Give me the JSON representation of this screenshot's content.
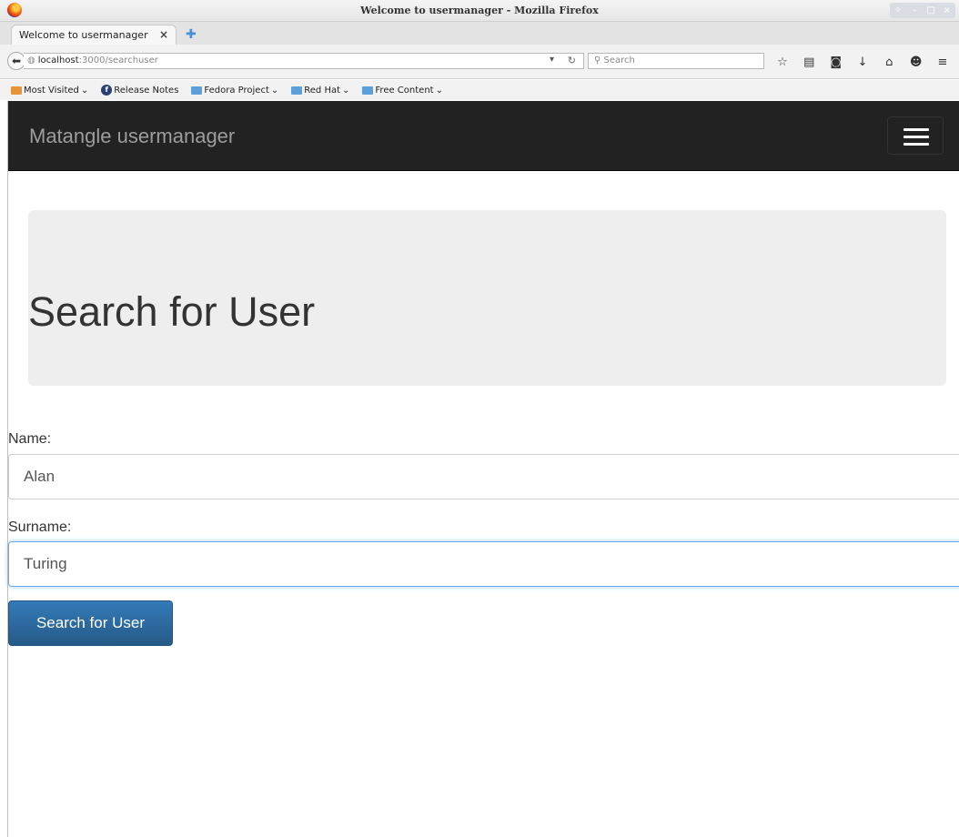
{
  "window": {
    "title": "Welcome to usermanager - Mozilla Firefox"
  },
  "tab": {
    "label": "Welcome to usermanager"
  },
  "urlbar": {
    "host": "localhost",
    "path": ":3000/searchuser"
  },
  "searchbar": {
    "placeholder": "Search"
  },
  "bookmarks": [
    {
      "label": "Most Visited",
      "icon": "folder-icon"
    },
    {
      "label": "Release Notes",
      "icon": "fedora-icon"
    },
    {
      "label": "Fedora Project",
      "icon": "folder-icon"
    },
    {
      "label": "Red Hat",
      "icon": "folder-icon"
    },
    {
      "label": "Free Content",
      "icon": "folder-icon"
    }
  ],
  "app": {
    "brand": "Matangle usermanager"
  },
  "page": {
    "heading": "Search for User",
    "name_label": "Name:",
    "name_value": "Alan",
    "surname_label": "Surname:",
    "surname_value": "Turing",
    "submit_label": "Search for User"
  },
  "colors": {
    "navbar": "#222222",
    "jumbotron": "#eeeeee",
    "primary": "#337ab7",
    "focus": "#66afe9"
  }
}
